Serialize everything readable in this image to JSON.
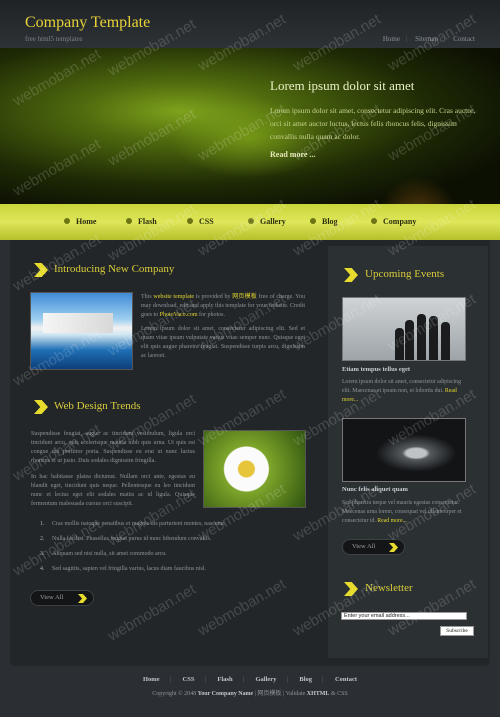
{
  "header": {
    "logo": "Company Template",
    "tagline": "free html5 templates",
    "topnav": [
      "Home",
      "Sitemap",
      "Contact"
    ]
  },
  "banner": {
    "title": "Lorem ipsum dolor sit amet",
    "text": "Lorem ipsum dolor sit amet, consectetur adipiscing elit. Cras auctor, orci sit amet auctor luctus, lectus felis rhoncus felis, dignissim convallis nulla quam ac dolor.",
    "more": "Read more ..."
  },
  "nav": [
    "Home",
    "Flash",
    "CSS",
    "Gallery",
    "Blog",
    "Company"
  ],
  "intro": {
    "heading": "Introducing New Company",
    "p1_a": "This ",
    "p1_link": "website template",
    "p1_b": " is provided by ",
    "p1_site": "网页模板",
    "p1_c": " free of charge. You may download, edit and apply this template for your website. Credit goes to ",
    "p1_credit": "PhotoVaco.com",
    "p1_d": " for photos.",
    "p2": "Lorem ipsum dolor sit amet, consectetur adipiscing elit. Sed et quam vitae ipsum vulputate varius vitae semper nunc. Quisque eget elit quis augue pharetra feugiat. Suspendisse turpis arcu, dignissim ac laoreet."
  },
  "trends": {
    "heading": "Web Design Trends",
    "p1": "Suspendisse feugiat, augue ac tincidunt vestibulum, ligula orci tincidunt arcu, quis scelerisque mauris nibh quis urna. Ut quis est congue dui porttitor porta. Suspendisse eu erat ut nunc luctus rhoncus et ut justo. Duis sodales dignissim fringilla.",
    "p2": "In hac habitasse platea dictumst. Nullam orci ante, egestas eu blandit eget, tincidunt quis neque. Pellentesque eu leo tincidunt nunc et lectus eget elit sodales mattis ac id ligula. Quisque fermentum malesuada cursus orci suscipit.",
    "list": [
      "Cras mollis natoque penatibus et magnis dis parturient montes, nascetur.",
      "Nulla facilisi. Phasellus feugiat purus id nunc bibendum convallis.",
      "Aliquam sed nisi nulla, sit amet commodo arcu.",
      "Sed sagittis, sapien vel fringilla varius, lacus diam faucibus nisl."
    ],
    "view_all": "View All"
  },
  "events": {
    "heading": "Upcoming Events",
    "items": [
      {
        "title": "Etiam tempus tellus eget",
        "text": "Lorem ipsum dolor sit amet, consectetur adipiscing elit. Maecenas et ipsum non, et lobortis dui.",
        "more": "Read more..."
      },
      {
        "title": "Nunc felis aliquet quam",
        "text": "Sed pharetra neque vel mauris egestas consectetur. Maecenas urna lorem, consequat vel ullamcorper et consectetur id.",
        "more": "Read more..."
      }
    ],
    "view_all": "View All"
  },
  "newsletter": {
    "heading": "Newsletter",
    "placeholder": "Enter your email address...",
    "button": "Subscribe"
  },
  "footer": {
    "nav": [
      "Home",
      "CSS",
      "Flash",
      "Gallery",
      "Blog",
      "Contact"
    ],
    "copy_a": "Copyright © 2048 ",
    "company": "Your Company Name",
    "copy_b": " | 网页模板 | Validate ",
    "xhtml": "XHTML",
    "copy_c": " & CSS"
  },
  "watermark": "webmoban.net",
  "colors": {
    "accent": "#e3d62e",
    "nav": "#d5de48",
    "background": "#2b2f33"
  }
}
